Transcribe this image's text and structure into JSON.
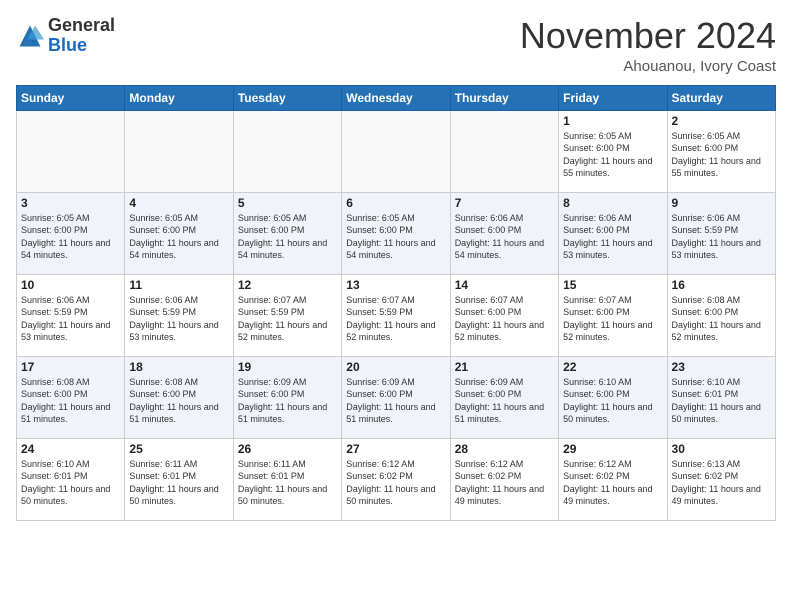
{
  "header": {
    "logo_general": "General",
    "logo_blue": "Blue",
    "month_title": "November 2024",
    "location": "Ahouanou, Ivory Coast"
  },
  "days_of_week": [
    "Sunday",
    "Monday",
    "Tuesday",
    "Wednesday",
    "Thursday",
    "Friday",
    "Saturday"
  ],
  "weeks": [
    [
      {
        "day": "",
        "empty": true
      },
      {
        "day": "",
        "empty": true
      },
      {
        "day": "",
        "empty": true
      },
      {
        "day": "",
        "empty": true
      },
      {
        "day": "",
        "empty": true
      },
      {
        "day": "1",
        "sunrise": "Sunrise: 6:05 AM",
        "sunset": "Sunset: 6:00 PM",
        "daylight": "Daylight: 11 hours and 55 minutes."
      },
      {
        "day": "2",
        "sunrise": "Sunrise: 6:05 AM",
        "sunset": "Sunset: 6:00 PM",
        "daylight": "Daylight: 11 hours and 55 minutes."
      }
    ],
    [
      {
        "day": "3",
        "sunrise": "Sunrise: 6:05 AM",
        "sunset": "Sunset: 6:00 PM",
        "daylight": "Daylight: 11 hours and 54 minutes."
      },
      {
        "day": "4",
        "sunrise": "Sunrise: 6:05 AM",
        "sunset": "Sunset: 6:00 PM",
        "daylight": "Daylight: 11 hours and 54 minutes."
      },
      {
        "day": "5",
        "sunrise": "Sunrise: 6:05 AM",
        "sunset": "Sunset: 6:00 PM",
        "daylight": "Daylight: 11 hours and 54 minutes."
      },
      {
        "day": "6",
        "sunrise": "Sunrise: 6:05 AM",
        "sunset": "Sunset: 6:00 PM",
        "daylight": "Daylight: 11 hours and 54 minutes."
      },
      {
        "day": "7",
        "sunrise": "Sunrise: 6:06 AM",
        "sunset": "Sunset: 6:00 PM",
        "daylight": "Daylight: 11 hours and 54 minutes."
      },
      {
        "day": "8",
        "sunrise": "Sunrise: 6:06 AM",
        "sunset": "Sunset: 6:00 PM",
        "daylight": "Daylight: 11 hours and 53 minutes."
      },
      {
        "day": "9",
        "sunrise": "Sunrise: 6:06 AM",
        "sunset": "Sunset: 5:59 PM",
        "daylight": "Daylight: 11 hours and 53 minutes."
      }
    ],
    [
      {
        "day": "10",
        "sunrise": "Sunrise: 6:06 AM",
        "sunset": "Sunset: 5:59 PM",
        "daylight": "Daylight: 11 hours and 53 minutes."
      },
      {
        "day": "11",
        "sunrise": "Sunrise: 6:06 AM",
        "sunset": "Sunset: 5:59 PM",
        "daylight": "Daylight: 11 hours and 53 minutes."
      },
      {
        "day": "12",
        "sunrise": "Sunrise: 6:07 AM",
        "sunset": "Sunset: 5:59 PM",
        "daylight": "Daylight: 11 hours and 52 minutes."
      },
      {
        "day": "13",
        "sunrise": "Sunrise: 6:07 AM",
        "sunset": "Sunset: 5:59 PM",
        "daylight": "Daylight: 11 hours and 52 minutes."
      },
      {
        "day": "14",
        "sunrise": "Sunrise: 6:07 AM",
        "sunset": "Sunset: 6:00 PM",
        "daylight": "Daylight: 11 hours and 52 minutes."
      },
      {
        "day": "15",
        "sunrise": "Sunrise: 6:07 AM",
        "sunset": "Sunset: 6:00 PM",
        "daylight": "Daylight: 11 hours and 52 minutes."
      },
      {
        "day": "16",
        "sunrise": "Sunrise: 6:08 AM",
        "sunset": "Sunset: 6:00 PM",
        "daylight": "Daylight: 11 hours and 52 minutes."
      }
    ],
    [
      {
        "day": "17",
        "sunrise": "Sunrise: 6:08 AM",
        "sunset": "Sunset: 6:00 PM",
        "daylight": "Daylight: 11 hours and 51 minutes."
      },
      {
        "day": "18",
        "sunrise": "Sunrise: 6:08 AM",
        "sunset": "Sunset: 6:00 PM",
        "daylight": "Daylight: 11 hours and 51 minutes."
      },
      {
        "day": "19",
        "sunrise": "Sunrise: 6:09 AM",
        "sunset": "Sunset: 6:00 PM",
        "daylight": "Daylight: 11 hours and 51 minutes."
      },
      {
        "day": "20",
        "sunrise": "Sunrise: 6:09 AM",
        "sunset": "Sunset: 6:00 PM",
        "daylight": "Daylight: 11 hours and 51 minutes."
      },
      {
        "day": "21",
        "sunrise": "Sunrise: 6:09 AM",
        "sunset": "Sunset: 6:00 PM",
        "daylight": "Daylight: 11 hours and 51 minutes."
      },
      {
        "day": "22",
        "sunrise": "Sunrise: 6:10 AM",
        "sunset": "Sunset: 6:00 PM",
        "daylight": "Daylight: 11 hours and 50 minutes."
      },
      {
        "day": "23",
        "sunrise": "Sunrise: 6:10 AM",
        "sunset": "Sunset: 6:01 PM",
        "daylight": "Daylight: 11 hours and 50 minutes."
      }
    ],
    [
      {
        "day": "24",
        "sunrise": "Sunrise: 6:10 AM",
        "sunset": "Sunset: 6:01 PM",
        "daylight": "Daylight: 11 hours and 50 minutes."
      },
      {
        "day": "25",
        "sunrise": "Sunrise: 6:11 AM",
        "sunset": "Sunset: 6:01 PM",
        "daylight": "Daylight: 11 hours and 50 minutes."
      },
      {
        "day": "26",
        "sunrise": "Sunrise: 6:11 AM",
        "sunset": "Sunset: 6:01 PM",
        "daylight": "Daylight: 11 hours and 50 minutes."
      },
      {
        "day": "27",
        "sunrise": "Sunrise: 6:12 AM",
        "sunset": "Sunset: 6:02 PM",
        "daylight": "Daylight: 11 hours and 50 minutes."
      },
      {
        "day": "28",
        "sunrise": "Sunrise: 6:12 AM",
        "sunset": "Sunset: 6:02 PM",
        "daylight": "Daylight: 11 hours and 49 minutes."
      },
      {
        "day": "29",
        "sunrise": "Sunrise: 6:12 AM",
        "sunset": "Sunset: 6:02 PM",
        "daylight": "Daylight: 11 hours and 49 minutes."
      },
      {
        "day": "30",
        "sunrise": "Sunrise: 6:13 AM",
        "sunset": "Sunset: 6:02 PM",
        "daylight": "Daylight: 11 hours and 49 minutes."
      }
    ]
  ]
}
